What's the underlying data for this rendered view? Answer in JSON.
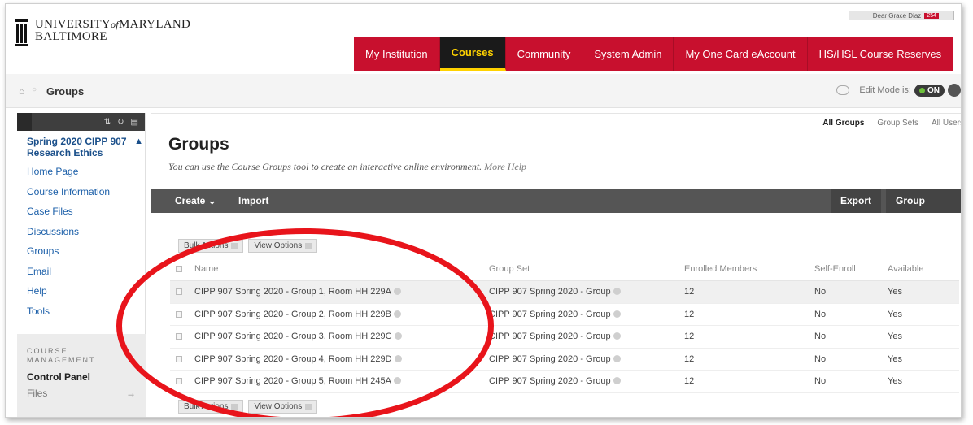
{
  "header": {
    "logo_line1": "UNIVERSITY",
    "logo_of": "of",
    "logo_line1b": "MARYLAND",
    "logo_line2": "BALTIMORE",
    "user_label": "Dear Grace Diaz",
    "user_badge": "254"
  },
  "nav": {
    "tabs": [
      "My Institution",
      "Courses",
      "Community",
      "System Admin",
      "My One Card eAccount",
      "HS/HSL Course Reserves"
    ],
    "active": "Courses"
  },
  "breadcrumb": {
    "current": "Groups"
  },
  "edit_mode": {
    "label": "Edit Mode is:",
    "state": "ON"
  },
  "sidebar": {
    "course_title": "Spring 2020 CIPP 907 Research Ethics",
    "items": [
      "Home Page",
      "Course Information",
      "Case Files",
      "Discussions",
      "Groups",
      "Email",
      "Help",
      "Tools"
    ],
    "management_label": "COURSE MANAGEMENT",
    "control_panel": "Control Panel",
    "files": "Files"
  },
  "main": {
    "subtabs": [
      "All Groups",
      "Group Sets",
      "All Users"
    ],
    "title": "Groups",
    "subtitle": "You can use the Course Groups tool to create an interactive online environment.",
    "more_help": "More Help",
    "create": "Create",
    "import": "Import",
    "export": "Export",
    "group_settings": "Group Settings",
    "bulk_actions": "Bulk Actions",
    "view_options": "View Options",
    "columns": [
      "Name",
      "Group Set",
      "Enrolled Members",
      "Self-Enroll",
      "Available"
    ],
    "rows": [
      {
        "name": "CIPP 907 Spring 2020 - Group 1, Room HH 229A",
        "set": "CIPP 907 Spring 2020 - Group",
        "members": "12",
        "self": "No",
        "available": "Yes"
      },
      {
        "name": "CIPP 907 Spring 2020 - Group 2, Room HH 229B",
        "set": "CIPP 907 Spring 2020 - Group",
        "members": "12",
        "self": "No",
        "available": "Yes"
      },
      {
        "name": "CIPP 907 Spring 2020 - Group 3, Room HH 229C",
        "set": "CIPP 907 Spring 2020 - Group",
        "members": "12",
        "self": "No",
        "available": "Yes"
      },
      {
        "name": "CIPP 907 Spring 2020 - Group 4, Room HH 229D",
        "set": "CIPP 907 Spring 2020 - Group",
        "members": "12",
        "self": "No",
        "available": "Yes"
      },
      {
        "name": "CIPP 907 Spring 2020 - Group 5, Room HH 245A",
        "set": "CIPP 907 Spring 2020 - Group",
        "members": "12",
        "self": "No",
        "available": "Yes"
      }
    ]
  },
  "colors": {
    "brand_red": "#c8102e",
    "active_gold": "#ffd200",
    "link_blue": "#1a5ea8",
    "highlight_oval": "#e8141b"
  }
}
